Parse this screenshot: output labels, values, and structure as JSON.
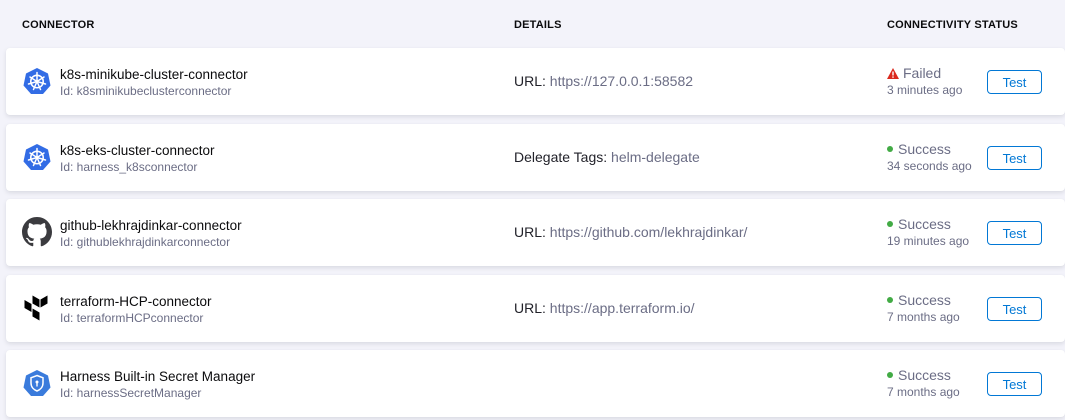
{
  "columns": {
    "connector": "CONNECTOR",
    "details": "DETAILS",
    "status": "CONNECTIVITY STATUS"
  },
  "connectors": [
    {
      "icon": "kubernetes-icon",
      "name": "k8s-minikube-cluster-connector",
      "id": "Id: k8sminikubeclusterconnector",
      "details_label": "URL: ",
      "details_value": "https://127.0.0.1:58582",
      "status": "Failed",
      "last_tested": "3 minutes ago",
      "test_label": "Test"
    },
    {
      "icon": "kubernetes-icon",
      "name": "k8s-eks-cluster-connector",
      "id": "Id: harness_k8sconnector",
      "details_label": "Delegate Tags: ",
      "details_value": "helm-delegate",
      "status": "Success",
      "last_tested": "34 seconds ago",
      "test_label": "Test"
    },
    {
      "icon": "github-icon",
      "name": "github-lekhrajdinkar-connector",
      "id": "Id: githublekhrajdinkarconnector",
      "details_label": "URL: ",
      "details_value": "https://github.com/lekhrajdinkar/",
      "status": "Success",
      "last_tested": "19 minutes ago",
      "test_label": "Test"
    },
    {
      "icon": "terraform-icon",
      "name": "terraform-HCP-connector",
      "id": "Id: terraformHCPconnector",
      "details_label": "URL: ",
      "details_value": "https://app.terraform.io/",
      "status": "Success",
      "last_tested": "7 months ago",
      "test_label": "Test"
    },
    {
      "icon": "secret-manager-icon",
      "name": "Harness Built-in Secret Manager",
      "id": "Id: harnessSecretManager",
      "details_label": "",
      "details_value": "",
      "status": "Success",
      "last_tested": "7 months ago",
      "test_label": "Test"
    }
  ],
  "colors": {
    "success": "#42ab45",
    "failed": "#da291d",
    "link": "#0278d5",
    "kubernetes": "#326ce5"
  }
}
